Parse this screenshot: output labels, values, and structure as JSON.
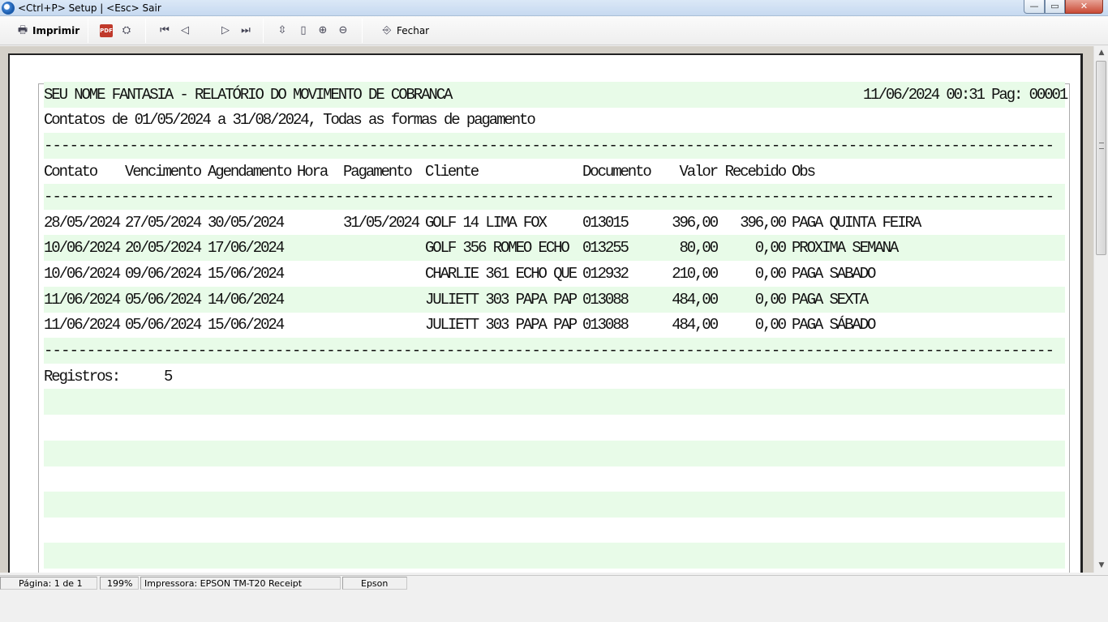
{
  "window": {
    "title": "<Ctrl+P> Setup | <Esc> Sair"
  },
  "toolbar": {
    "print_label": "Imprimir",
    "close_label": "Fechar",
    "pdf_label": "PDF"
  },
  "report": {
    "header_left": "SEU NOME FANTASIA - RELATÓRIO DO MOVIMENTO DE COBRANCA",
    "header_right": "11/06/2024 00:31 Pag: 00001",
    "subtitle": "Contatos de 01/05/2024 a 31/08/2024, Todas as formas de pagamento",
    "separator": "----------------------------------------------------------------------------------------------------------------------",
    "columns": [
      "Contato",
      "Vencimento",
      "Agendamento",
      "Hora",
      "Pagamento",
      "Cliente",
      "Documento",
      "Valor",
      "Recebido",
      "Obs"
    ],
    "rows": [
      [
        "28/05/2024",
        "27/05/2024",
        "30/05/2024",
        "",
        "31/05/2024",
        "GOLF 14 LIMA FOX",
        "013015",
        "396,00",
        "396,00",
        "PAGA QUINTA FEIRA"
      ],
      [
        "10/06/2024",
        "20/05/2024",
        "17/06/2024",
        "",
        "",
        "GOLF 356 ROMEO ECHO",
        "013255",
        "80,00",
        "0,00",
        "PROXIMA SEMANA"
      ],
      [
        "10/06/2024",
        "09/06/2024",
        "15/06/2024",
        "",
        "",
        "CHARLIE 361 ECHO QUE",
        "012932",
        "210,00",
        "0,00",
        "PAGA SABADO"
      ],
      [
        "11/06/2024",
        "05/06/2024",
        "14/06/2024",
        "",
        "",
        "JULIETT 303 PAPA PAP",
        "013088",
        "484,00",
        "0,00",
        "PAGA SEXTA"
      ],
      [
        "11/06/2024",
        "05/06/2024",
        "15/06/2024",
        "",
        "",
        "JULIETT 303 PAPA PAP",
        "013088",
        "484,00",
        "0,00",
        "PAGA SÁBADO"
      ]
    ],
    "footer_label": "Registros:",
    "footer_count": "5"
  },
  "statusbar": {
    "page": "Página: 1 de 1",
    "zoom": "199%",
    "printer": "Impressora: EPSON TM-T20 Receipt",
    "driver": "Epson"
  }
}
